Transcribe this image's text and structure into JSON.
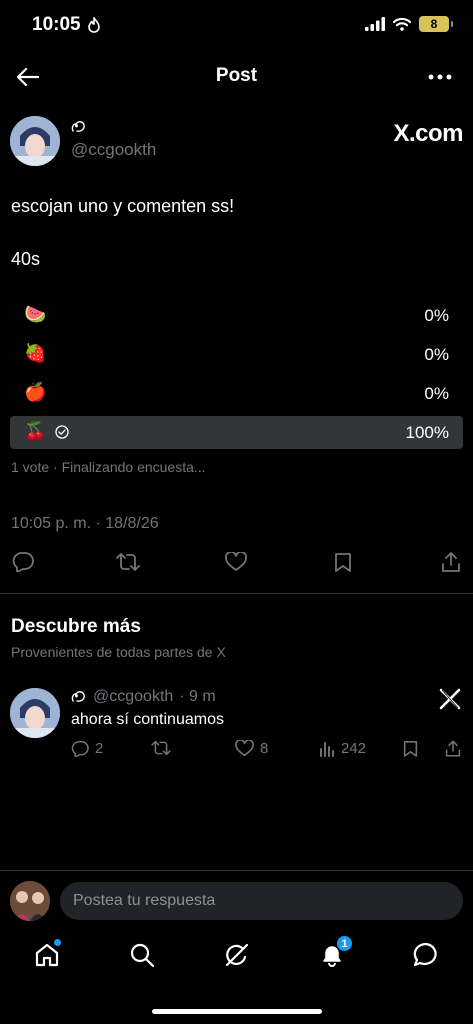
{
  "status_bar": {
    "time": "10:05",
    "battery": "8"
  },
  "header": {
    "title": "Post"
  },
  "post": {
    "handle": "@ccgookth",
    "source_logo": "X.com",
    "text": "escojan uno y comenten ss!",
    "time_left": "40s",
    "poll": {
      "options": [
        {
          "emoji": "🍉",
          "percent": "0%",
          "fraction": 0,
          "selected": false
        },
        {
          "emoji": "🍓",
          "percent": "0%",
          "fraction": 0,
          "selected": false
        },
        {
          "emoji": "🍎",
          "percent": "0%",
          "fraction": 0,
          "selected": false
        },
        {
          "emoji": "🍒",
          "percent": "100%",
          "fraction": 1,
          "selected": true
        }
      ],
      "meta": "1 vote · Finalizando encuesta..."
    },
    "timestamp": "10:05 p. m. · 18/8/26"
  },
  "discover": {
    "title": "Descubre más",
    "subtitle": "Provenientes de todas partes de X"
  },
  "recommended": {
    "handle": "@ccgookth",
    "age": "· 9 m",
    "text": "ahora sí continuamos",
    "replies": "2",
    "likes": "8",
    "views": "242"
  },
  "reply_bar": {
    "placeholder": "Postea tu respuesta"
  },
  "tabbar": {
    "notifications_badge": "1"
  },
  "colors": {
    "accent": "#1d9bf0",
    "muted": "#71767b",
    "poll_fill": "#333639"
  }
}
